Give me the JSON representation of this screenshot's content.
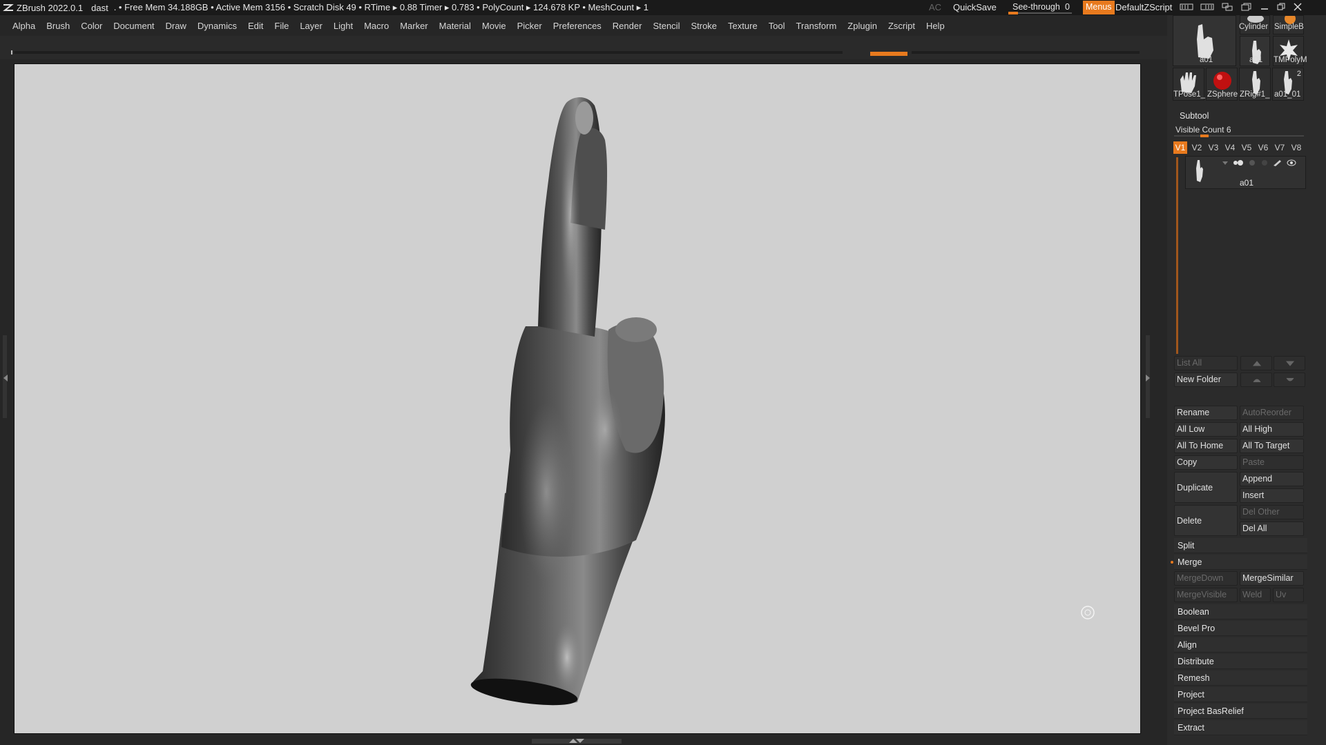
{
  "titlebar": {
    "app": "ZBrush 2022.0.1",
    "doc": "dast",
    "stats": ". • Free Mem 34.188GB • Active Mem 3156 • Scratch Disk 49 • RTime ▸ 0.88 Timer ▸ 0.783 • PolyCount ▸ 124.678 KP • MeshCount ▸ 1",
    "ac": "AC",
    "quicksave": "QuickSave",
    "seethrough_label": "See-through",
    "seethrough_value": "0",
    "menus": "Menus",
    "zscript": "DefaultZScript"
  },
  "menubar": {
    "items": [
      "Alpha",
      "Brush",
      "Color",
      "Document",
      "Draw",
      "Dynamics",
      "Edit",
      "File",
      "Layer",
      "Light",
      "Macro",
      "Marker",
      "Material",
      "Movie",
      "Picker",
      "Preferences",
      "Render",
      "Stencil",
      "Stroke",
      "Texture",
      "Tool",
      "Transform",
      "Zplugin",
      "Zscript",
      "Help"
    ]
  },
  "tool_thumbs": {
    "top_labels": [
      "a01",
      "a01",
      "Cylinder",
      "SimpleB",
      "TMPolyM"
    ],
    "bottom_labels": [
      "TPose1_",
      "ZSphere",
      "ZRig#1_",
      "a01_01"
    ],
    "badge": "2"
  },
  "subtool": {
    "title": "Subtool",
    "visible_count_label": "Visible Count 6",
    "visible_count_fraction": 0.2,
    "tabs": [
      "V1",
      "V2",
      "V3",
      "V4",
      "V5",
      "V6",
      "V7",
      "V8"
    ],
    "active_tab": "V1",
    "item_name": "a01",
    "buttons": {
      "list_all": "List All",
      "new_folder": "New Folder",
      "rename": "Rename",
      "autoreorder": "AutoReorder",
      "all_low": "All Low",
      "all_high": "All High",
      "all_to_home": "All To Home",
      "all_to_target": "All To Target",
      "copy": "Copy",
      "paste": "Paste",
      "duplicate": "Duplicate",
      "append": "Append",
      "insert": "Insert",
      "delete": "Delete",
      "del_other": "Del Other",
      "del_all": "Del All",
      "split": "Split",
      "merge": "Merge",
      "mergedown": "MergeDown",
      "mergesimilar": "MergeSimilar",
      "mergevisible": "MergeVisible",
      "weld": "Weld",
      "uv": "Uv",
      "boolean": "Boolean",
      "bevel_pro": "Bevel Pro",
      "align": "Align",
      "distribute": "Distribute",
      "remesh": "Remesh",
      "project": "Project",
      "project_basrelief": "Project BasRelief",
      "extract": "Extract"
    }
  },
  "colors": {
    "accent": "#e87a1e",
    "viewport_bg": "#d0d0d0",
    "panel_bg": "#2b2b2b"
  }
}
